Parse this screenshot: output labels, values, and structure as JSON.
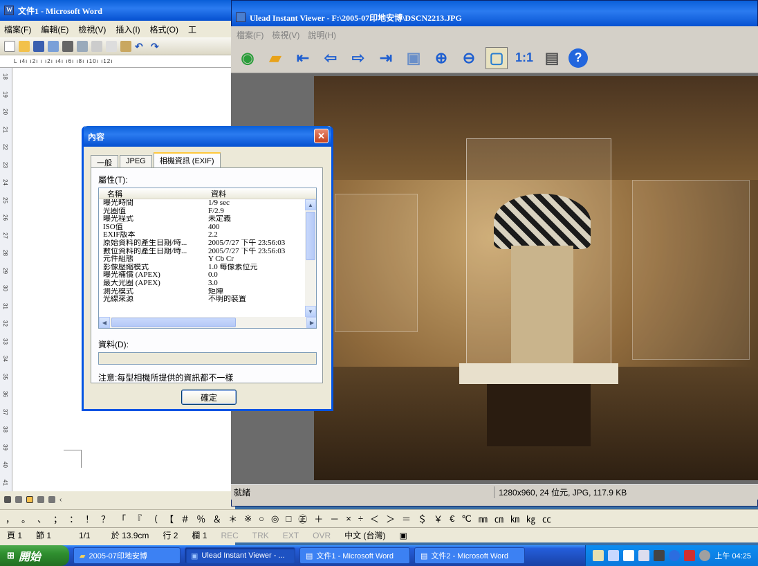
{
  "word": {
    "title": "文件1 - Microsoft Word",
    "menus": [
      "檔案(F)",
      "編輯(E)",
      "檢視(V)",
      "插入(I)",
      "格式(O)",
      "工"
    ],
    "ruler_text": "L ı4ı ı2ı ı ı2ı ı4ı ı6ı ı8ı ı10ı ı12ı",
    "vertical_ruler": [
      "18",
      "19",
      "20",
      "21",
      "22",
      "23",
      "24",
      "25",
      "26",
      "27",
      "28",
      "29",
      "30",
      "31",
      "32",
      "33",
      "34",
      "35",
      "36",
      "37",
      "38",
      "39",
      "40",
      "41"
    ]
  },
  "viewer": {
    "title": "Ulead Instant Viewer - F:\\2005-07印地安博\\DSCN2213.JPG",
    "menus": [
      "檔案(F)",
      "檢視(V)",
      "說明(H)"
    ],
    "status_left": "就緒",
    "status_right": "1280x960, 24 位元, JPG, 117.9 KB"
  },
  "dialog": {
    "title": "內容",
    "tabs": [
      "一般",
      "JPEG",
      "相機資訊 (EXIF)"
    ],
    "properties_label": "屬性(T):",
    "col_name": "名稱",
    "col_value": "資料",
    "rows": [
      {
        "name": "曝光時間",
        "value": "1/9 sec"
      },
      {
        "name": "光圈值",
        "value": "F/2.9"
      },
      {
        "name": "曝光程式",
        "value": "未定義"
      },
      {
        "name": "ISO值",
        "value": "400"
      },
      {
        "name": "EXIF版本",
        "value": "2.2"
      },
      {
        "name": "原始資料的產生日期/時...",
        "value": "2005/7/27 下午 23:56:03"
      },
      {
        "name": "數位資料的產生日期/時...",
        "value": "2005/7/27 下午 23:56:03"
      },
      {
        "name": "元件組態",
        "value": "Y Cb Cr"
      },
      {
        "name": "影像壓縮模式",
        "value": "1.0 每像素位元"
      },
      {
        "name": "曝光補償 (APEX)",
        "value": "0.0"
      },
      {
        "name": "最大光圈 (APEX)",
        "value": "3.0"
      },
      {
        "name": "測光模式",
        "value": "矩陣"
      },
      {
        "name": "光線來源",
        "value": "不明的裝置"
      }
    ],
    "data_label": "資料(D):",
    "note": "注意:每型相機所提供的資訊都不一樣",
    "ok": "確定"
  },
  "symbols": [
    "，",
    "。",
    "、",
    "；",
    "：",
    "！",
    "？",
    "「",
    "『",
    "（",
    "【",
    "＃",
    "％",
    "＆",
    "＊",
    "※",
    "○",
    "◎",
    "□",
    "㊣",
    "＋",
    "－",
    "×",
    "÷",
    "＜",
    "＞",
    "＝",
    "＄",
    "￥",
    "€",
    "℃",
    "㎜",
    "㎝",
    "㎞",
    "㎏",
    "㏄"
  ],
  "word_status": {
    "page": "頁 1",
    "section": "節 1",
    "pages": "1/1",
    "at": "於 13.9cm",
    "line": "行 2",
    "col": "欄 1",
    "rec": "REC",
    "trk": "TRK",
    "ext": "EXT",
    "ovr": "OVR",
    "lang": "中文 (台灣)"
  },
  "taskbar": {
    "start": "開始",
    "tasks": [
      "2005-07印地安博",
      "Ulead Instant Viewer - ...",
      "文件1 - Microsoft Word",
      "文件2 - Microsoft Word"
    ],
    "clock": "上午 04:25"
  }
}
